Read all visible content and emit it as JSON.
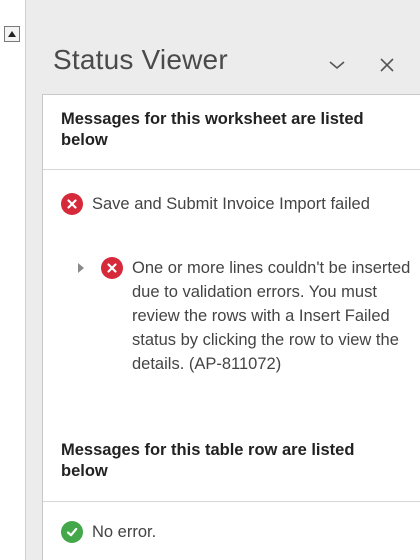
{
  "pane": {
    "title": "Status Viewer",
    "minimize_icon": "chevron-down-icon",
    "close_icon": "close-icon"
  },
  "sections": [
    {
      "heading": "Messages for this worksheet are listed below",
      "messages": [
        {
          "status": "error",
          "text": "Save and Submit Invoice Import failed"
        },
        {
          "status": "error",
          "expandable": true,
          "text": "One or more lines couldn't be inserted due to validation errors. You must review the rows with a Insert Failed status by clicking the row to view the details. (AP-811072)"
        }
      ]
    },
    {
      "heading": "Messages for this table row are listed below",
      "messages": [
        {
          "status": "success",
          "text": "No error."
        }
      ]
    }
  ],
  "colors": {
    "error": "#d62a3a",
    "success": "#43a84a",
    "pane_bg": "#ececec",
    "panel_bg": "#ffffff"
  }
}
